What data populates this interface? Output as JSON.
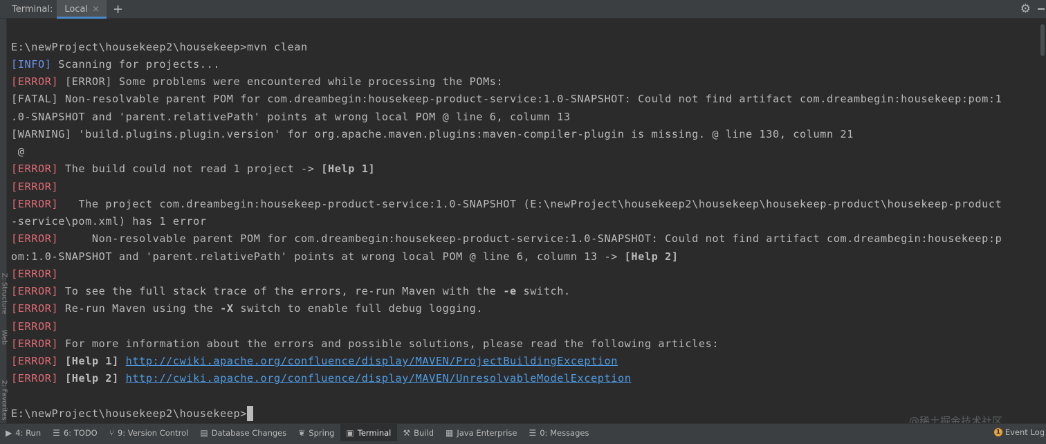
{
  "header": {
    "terminal_label": "Terminal:",
    "tab_local": "Local",
    "tab_close": "×",
    "add": "+",
    "gear": "⚙"
  },
  "terminal": {
    "lines": [
      {
        "text": "E:\\newProject\\housekeep2\\housekeep>mvn clean"
      },
      {
        "tag": "[INFO]",
        "kind": "info",
        "text": " Scanning for projects..."
      },
      {
        "tag": "[ERROR]",
        "kind": "err",
        "text": " [ERROR] Some problems were encountered while processing the POMs:"
      },
      {
        "text": "[FATAL] Non-resolvable parent POM for com.dreambegin:housekeep-product-service:1.0-SNAPSHOT: Could not find artifact com.dreambegin:housekeep:pom:1"
      },
      {
        "text": ".0-SNAPSHOT and 'parent.relativePath' points at wrong local POM @ line 6, column 13"
      },
      {
        "text": "[WARNING] 'build.plugins.plugin.version' for org.apache.maven.plugins:maven-compiler-plugin is missing. @ line 130, column 21"
      },
      {
        "text": " @"
      },
      {
        "tag": "[ERROR]",
        "kind": "err",
        "text": " The build could not read 1 project -> ",
        "bold": "[Help 1]"
      },
      {
        "tag": "[ERROR]",
        "kind": "err",
        "text": ""
      },
      {
        "tag": "[ERROR]",
        "kind": "err",
        "text": "   The project com.dreambegin:housekeep-product-service:1.0-SNAPSHOT (E:\\newProject\\housekeep2\\housekeep\\housekeep-product\\housekeep-product"
      },
      {
        "text": "-service\\pom.xml) has 1 error"
      },
      {
        "tag": "[ERROR]",
        "kind": "err",
        "text": "     Non-resolvable parent POM for com.dreambegin:housekeep-product-service:1.0-SNAPSHOT: Could not find artifact com.dreambegin:housekeep:p"
      },
      {
        "text": "om:1.0-SNAPSHOT and 'parent.relativePath' points at wrong local POM @ line 6, column 13 -> ",
        "bold": "[Help 2]"
      },
      {
        "tag": "[ERROR]",
        "kind": "err",
        "text": ""
      },
      {
        "tag": "[ERROR]",
        "kind": "err",
        "text": " To see the full stack trace of the errors, re-run Maven with the ",
        "bold": "-e",
        "text2": " switch."
      },
      {
        "tag": "[ERROR]",
        "kind": "err",
        "text": " Re-run Maven using the ",
        "bold": "-X",
        "text2": " switch to enable full debug logging."
      },
      {
        "tag": "[ERROR]",
        "kind": "err",
        "text": ""
      },
      {
        "tag": "[ERROR]",
        "kind": "err",
        "text": " For more information about the errors and possible solutions, please read the following articles:"
      },
      {
        "tag": "[ERROR]",
        "kind": "err",
        "text": " ",
        "bold": "[Help 1]",
        "text2": " ",
        "link": "http://cwiki.apache.org/confluence/display/MAVEN/ProjectBuildingException"
      },
      {
        "tag": "[ERROR]",
        "kind": "err",
        "text": " ",
        "bold": "[Help 2]",
        "text2": " ",
        "link": "http://cwiki.apache.org/confluence/display/MAVEN/UnresolvableModelException"
      },
      {
        "text": ""
      },
      {
        "text": "E:\\newProject\\housekeep2\\housekeep>",
        "cursor": true
      }
    ]
  },
  "left_strip_labels": [
    "Z: Structure",
    "Web",
    "2: Favorites"
  ],
  "bottom_tabs": [
    {
      "label": "4: Run",
      "icon": "▶",
      "icon_name": "run-icon"
    },
    {
      "label": "6: TODO",
      "icon": "☰",
      "icon_name": "todo-icon"
    },
    {
      "label": "9: Version Control",
      "icon": "⑂",
      "icon_name": "version-control-icon"
    },
    {
      "label": "Database Changes",
      "icon": "▤",
      "icon_name": "database-icon"
    },
    {
      "label": "Spring",
      "icon": "❦",
      "icon_name": "spring-icon"
    },
    {
      "label": "Terminal",
      "icon": "▣",
      "icon_name": "terminal-icon",
      "active": true
    },
    {
      "label": "Build",
      "icon": "⚒",
      "icon_name": "build-icon"
    },
    {
      "label": "Java Enterprise",
      "icon": "▦",
      "icon_name": "java-enterprise-icon"
    },
    {
      "label": "0: Messages",
      "icon": "☰",
      "icon_name": "messages-icon"
    }
  ],
  "watermark": "@稀土掘金技术社区",
  "event_log": {
    "count": "1",
    "label": "Event Log"
  },
  "colors": {
    "info": "#6c95eb",
    "error": "#e06c75",
    "link": "#4e9ce4",
    "text": "#bbbbbb",
    "background": "#2b2b2b"
  }
}
